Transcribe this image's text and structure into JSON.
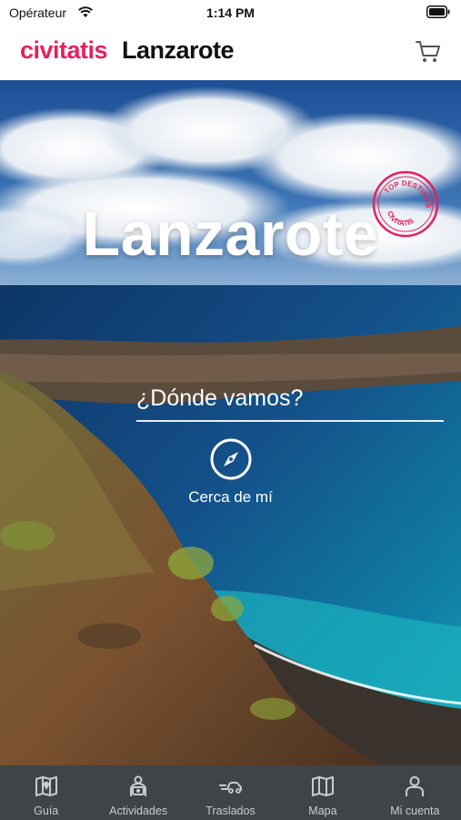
{
  "status": {
    "carrier": "Opérateur",
    "time": "1:14 PM"
  },
  "header": {
    "brand": "civitatis",
    "city": "Lanzarote"
  },
  "hero": {
    "title": "Lanzarote",
    "badge": {
      "top_text": "TOP DESTINOS",
      "bottom_text": "CIVITATIS"
    },
    "search_placeholder": "¿Dónde vamos?",
    "nearby_label": "Cerca de mí"
  },
  "tabs": [
    {
      "label": "Guía",
      "icon": "map-guide-icon"
    },
    {
      "label": "Actividades",
      "icon": "activities-icon"
    },
    {
      "label": "Traslados",
      "icon": "transfer-icon"
    },
    {
      "label": "Mapa",
      "icon": "map-icon"
    },
    {
      "label": "Mi cuenta",
      "icon": "user-icon"
    }
  ],
  "colors": {
    "brand": "#e4215e",
    "tabbar": "#3f4448"
  }
}
